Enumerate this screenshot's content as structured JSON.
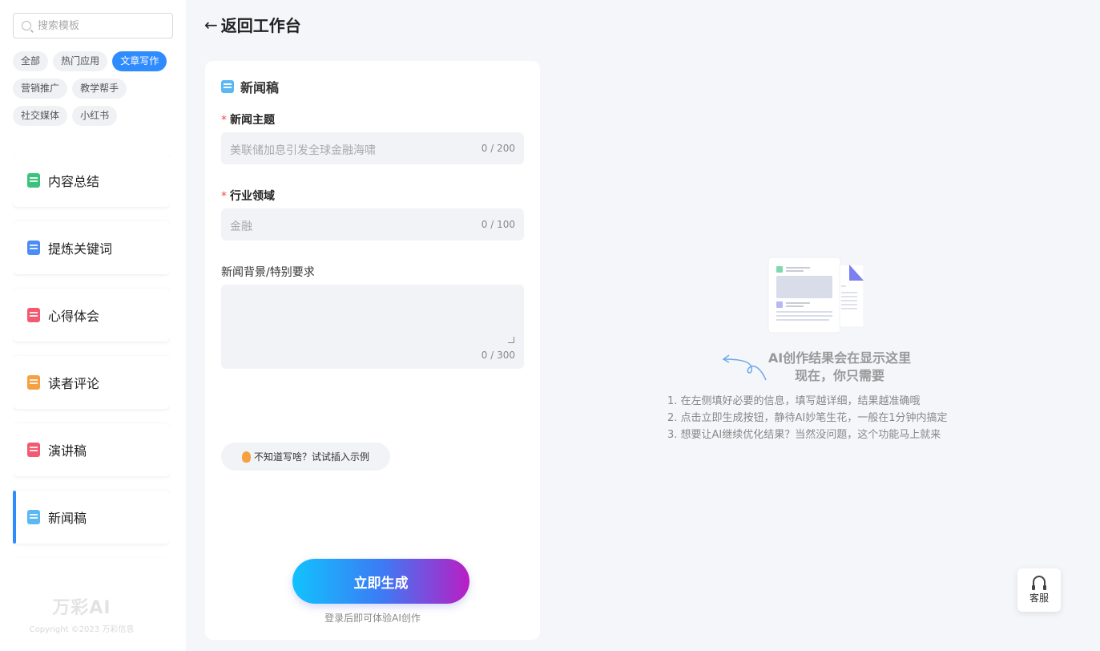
{
  "search": {
    "placeholder": "搜索模板"
  },
  "tags": [
    "全部",
    "热门应用",
    "文章写作",
    "营销推广",
    "教学帮手",
    "社交媒体",
    "小红书"
  ],
  "active_tag": "文章写作",
  "menu": [
    {
      "label": "内容总结",
      "icon": "summary-icon",
      "color": "#3cc27a"
    },
    {
      "label": "提炼关键词",
      "icon": "keyword-icon",
      "color": "#4b8cf5"
    },
    {
      "label": "心得体会",
      "icon": "heart-note-icon",
      "color": "#f25a72"
    },
    {
      "label": "读者评论",
      "icon": "pencil-icon",
      "color": "#f5a142"
    },
    {
      "label": "演讲稿",
      "icon": "speech-icon",
      "color": "#f25a72"
    },
    {
      "label": "新闻稿",
      "icon": "news-icon",
      "color": "#5ab8f5"
    }
  ],
  "active_menu": "新闻稿",
  "brand": {
    "logo": "万彩AI",
    "copyright": "Copyright ©2023 万彩信息"
  },
  "header": {
    "back_label": "返回工作台"
  },
  "form": {
    "title": "新闻稿",
    "fields": [
      {
        "label": "新闻主题",
        "required": true,
        "placeholder": "美联储加息引发全球金融海啸",
        "counter": "0 / 200"
      },
      {
        "label": "行业领域",
        "required": true,
        "placeholder": "金融",
        "counter": "0 / 100"
      },
      {
        "label": "新闻背景/特别要求",
        "required": false,
        "placeholder": "",
        "counter": "0 / 300"
      }
    ],
    "hint_button": "不知道写啥？试试插入示例",
    "generate_button": "立即生成",
    "generate_note": "登录后即可体验AI创作"
  },
  "result": {
    "title_line1": "AI创作结果会在显示这里",
    "title_line2": "现在，你只需要",
    "steps": [
      "1. 在左侧填好必要的信息，填写越详细，结果越准确哦",
      "2. 点击立即生成按钮，静待AI妙笔生花，一般在1分钟内搞定",
      "3. 想要让AI继续优化结果？当然没问题，这个功能马上就来"
    ]
  },
  "support": {
    "label": "客服"
  }
}
